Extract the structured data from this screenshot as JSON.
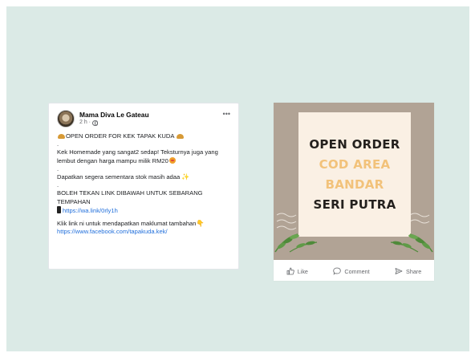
{
  "post": {
    "author": "Mama Diva Le Gateau",
    "time": "2 h ·",
    "more": "•••",
    "lines": {
      "l1": "OPEN ORDER FOR KEK TAPAK KUDA",
      "l2": ".",
      "l3": "Kek Homemade yang sangat2 sedap! Teksturnya juga yang lembut dengan harga mampu milik RM20",
      "l4": ".",
      "l5": "Dapatkan segera sementara stok masih adaa",
      "l6": ".",
      "l7": "BOLEH TEKAN LINK DIBAWAH UNTUK SEBARANG TEMPAHAN",
      "link1": "https://wa.link/0rly1h",
      "l8": "Klik link ni untuk mendapatkan maklumat tambahan",
      "link2": "https://www.facebook.com/tapakuda.kek/"
    }
  },
  "image_post": {
    "graphic_lines": [
      "OPEN ORDER",
      "COD AREA",
      "BANDAR",
      "SERI PUTRA"
    ],
    "colors": {
      "background": "#b1a395",
      "panel": "#faf0e4",
      "dark_text": "#24211e",
      "accent_text": "#f2c27a",
      "leaves": "#4f8a3a"
    },
    "actions": {
      "like": "Like",
      "comment": "Comment",
      "share": "Share"
    }
  },
  "icons": [
    "globe-icon",
    "more-icon",
    "bun-icon",
    "face-icon",
    "sparkle-icon",
    "phone-icon",
    "hand-icon",
    "like-icon",
    "comment-icon",
    "share-icon"
  ]
}
